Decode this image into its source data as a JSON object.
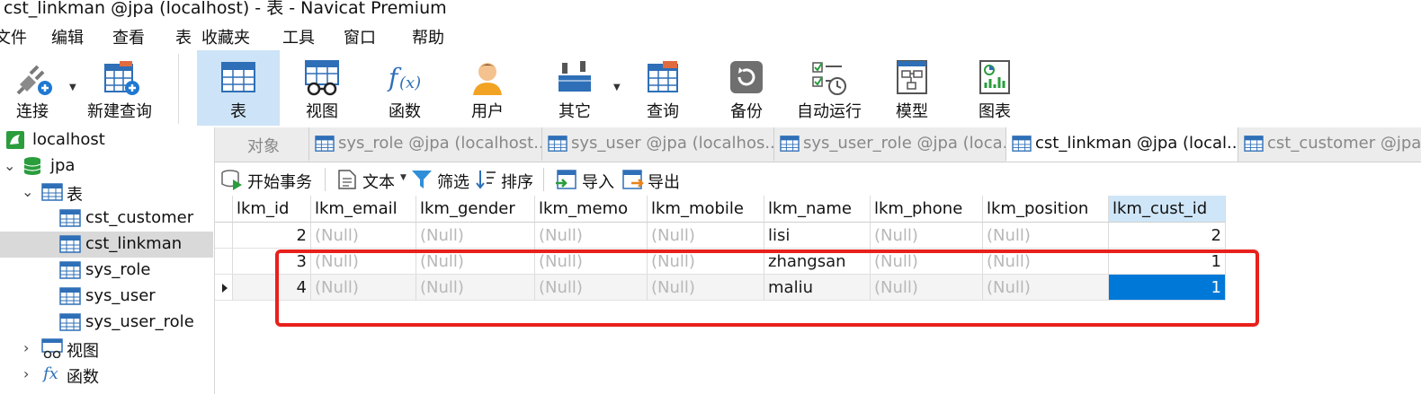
{
  "window": {
    "title": "cst_linkman @jpa (localhost) - 表 - Navicat Premium"
  },
  "menu": [
    "文件",
    "编辑",
    "查看",
    "表",
    "收藏夹",
    "工具",
    "窗口",
    "帮助"
  ],
  "toolbar": {
    "buttons": [
      {
        "label": "连接",
        "icon": "connect-icon"
      },
      {
        "label": "新建查询",
        "icon": "new-query-icon"
      },
      {
        "label": "表",
        "icon": "table-icon",
        "active": true
      },
      {
        "label": "视图",
        "icon": "view-icon"
      },
      {
        "label": "函数",
        "icon": "function-icon"
      },
      {
        "label": "用户",
        "icon": "user-icon"
      },
      {
        "label": "其它",
        "icon": "other-icon"
      },
      {
        "label": "查询",
        "icon": "query-icon"
      },
      {
        "label": "备份",
        "icon": "backup-icon"
      },
      {
        "label": "自动运行",
        "icon": "auto-run-icon"
      },
      {
        "label": "模型",
        "icon": "model-icon"
      },
      {
        "label": "图表",
        "icon": "chart-icon"
      }
    ]
  },
  "sidebar": {
    "connection": "localhost",
    "database": "jpa",
    "tables_group": "表",
    "tables": [
      "cst_customer",
      "cst_linkman",
      "sys_role",
      "sys_user",
      "sys_user_role"
    ],
    "selected_table": "cst_linkman",
    "views_group": "视图",
    "functions_group": "函数",
    "fx_glyph": "fx"
  },
  "tabs": {
    "object_tab": "对象",
    "items": [
      {
        "label": "sys_role @jpa (localhost..."
      },
      {
        "label": "sys_user @jpa (localhos..."
      },
      {
        "label": "sys_user_role @jpa (loca..."
      },
      {
        "label": "cst_linkman @jpa (local...",
        "active": true
      },
      {
        "label": "cst_customer @jpa"
      }
    ]
  },
  "object_toolbar": {
    "begin_transaction": "开始事务",
    "text": "文本",
    "filter": "筛选",
    "sort": "排序",
    "import": "导入",
    "export": "导出"
  },
  "grid": {
    "columns": [
      "lkm_id",
      "lkm_email",
      "lkm_gender",
      "lkm_memo",
      "lkm_mobile",
      "lkm_name",
      "lkm_phone",
      "lkm_position",
      "lkm_cust_id"
    ],
    "rows": [
      [
        "2",
        "(Null)",
        "(Null)",
        "(Null)",
        "(Null)",
        "lisi",
        "(Null)",
        "(Null)",
        "2"
      ],
      [
        "3",
        "(Null)",
        "(Null)",
        "(Null)",
        "(Null)",
        "zhangsan",
        "(Null)",
        "(Null)",
        "1"
      ],
      [
        "4",
        "(Null)",
        "(Null)",
        "(Null)",
        "(Null)",
        "maliu",
        "(Null)",
        "(Null)",
        "1"
      ]
    ],
    "current_row": 2,
    "selected_column": "lkm_cust_id",
    "highlight_color": "#e8201c",
    "selection_color": "#0078d7"
  }
}
